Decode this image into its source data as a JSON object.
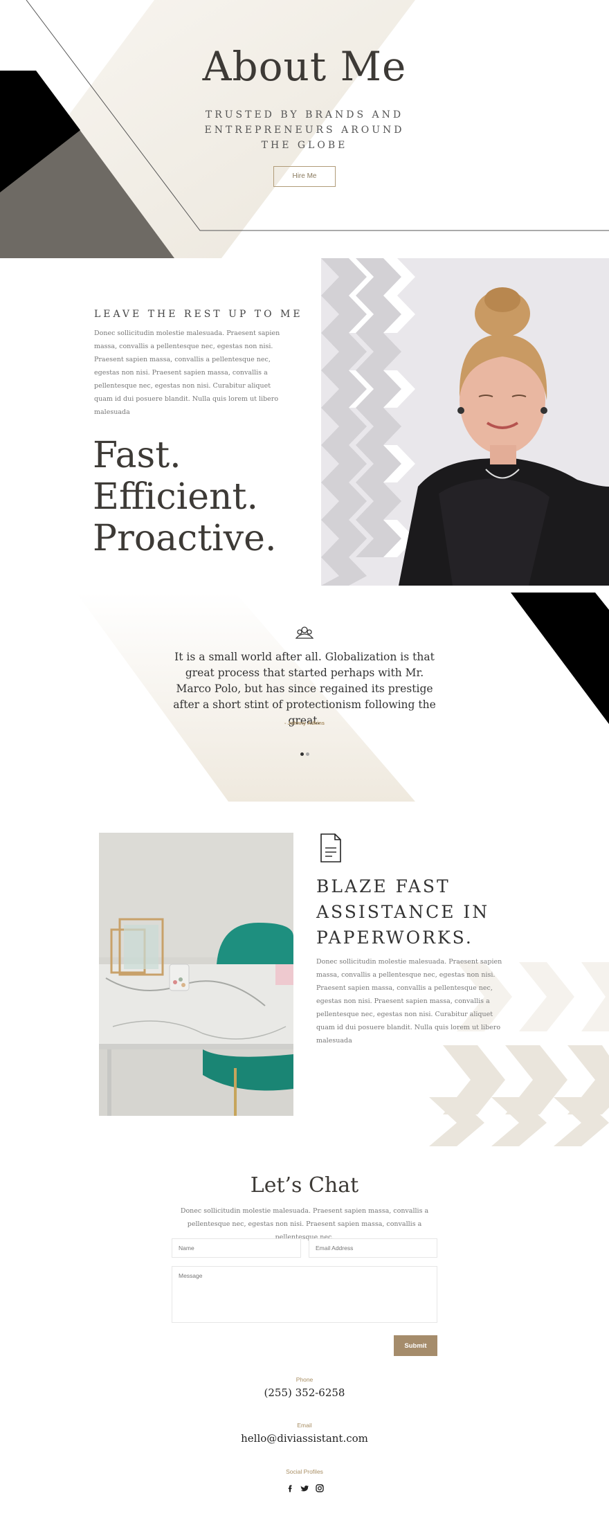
{
  "hero": {
    "title": "About Me",
    "subtitle": "TRUSTED BY BRANDS AND ENTREPRENEURS AROUND THE GLOBE",
    "button_label": "Hire Me"
  },
  "about": {
    "heading": "LEAVE THE REST UP TO ME",
    "body": "Donec sollicitudin molestie malesuada. Praesent sapien massa, convallis a pellentesque nec, egestas non nisi. Praesent sapien massa, convallis a pellentesque nec, egestas non nisi. Praesent sapien massa, convallis a pellentesque nec, egestas non nisi. Curabitur aliquet quam id dui posuere blandit. Nulla quis lorem ut libero malesuada",
    "tagline": [
      "Fast.",
      "Efficient.",
      "Proactive."
    ]
  },
  "testimonial": {
    "icon": "people-icon",
    "quote": "It is a small world after all. Globalization is that great process that started perhaps with Mr. Marco Polo, but has since regained its prestige after a short stint of protectionism following the great.",
    "author": "- Johnny Adkins"
  },
  "paperwork": {
    "icon": "document-icon",
    "heading": "BLAZE FAST ASSISTANCE IN PAPERWORKS.",
    "body": "Donec sollicitudin molestie malesuada. Praesent sapien massa, convallis a pellentesque nec, egestas non nisi. Praesent sapien massa, convallis a pellentesque nec, egestas non nisi. Praesent sapien massa, convallis a pellentesque nec, egestas non nisi. Curabitur aliquet quam id dui posuere blandit. Nulla quis lorem ut libero malesuada"
  },
  "chat": {
    "title": "Let’s Chat",
    "body": "Donec sollicitudin molestie malesuada. Praesent sapien massa, convallis a pellentesque nec, egestas non nisi. Praesent sapien massa, convallis a pellentesque nec.",
    "name_placeholder": "Name",
    "email_placeholder": "Email Address",
    "message_placeholder": "Message",
    "submit_label": "Submit"
  },
  "contact": {
    "phone_label": "Phone",
    "phone": "(255) 352-6258",
    "email_label": "Email",
    "email": "hello@diviassistant.com",
    "social_label": "Social Profiles",
    "social_icons": [
      "facebook-icon",
      "twitter-icon",
      "instagram-icon"
    ]
  },
  "colors": {
    "accent": "#a58c6b",
    "beige": "#ece6da",
    "dark": "#000000",
    "gray": "#6e6a64"
  }
}
